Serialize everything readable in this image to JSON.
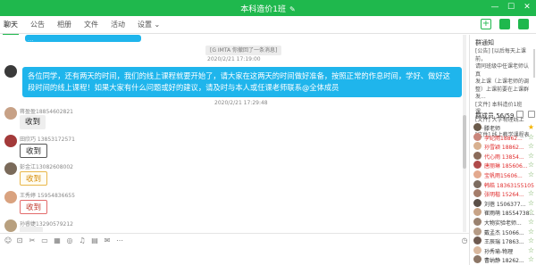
{
  "window": {
    "title": "本科造价1班",
    "edit_glyph": "✎",
    "controls": [
      "—",
      "☐",
      "✕"
    ]
  },
  "tabs": [
    {
      "label": "聊天",
      "active": true
    },
    {
      "label": "公告"
    },
    {
      "label": "相册"
    },
    {
      "label": "文件"
    },
    {
      "label": "活动"
    },
    {
      "label": "设置 ⌄"
    }
  ],
  "chat": {
    "top_bubble_text": "...",
    "system_notice": "[G IMTA 你撤回了一条消息]",
    "stamp1": "2020/2/21 17:19:00",
    "main_message": "各位同学，还有两天的时间，我们的线上课程就要开始了，请大家在这两天的时间做好准备，按照正常的作息时间，学好、做好这段时间的线上课程！如果大家有什么问题或好的建议，请及时与本人或任课老师联系@全体成员",
    "stamp2": "2020/2/21 17:29:48",
    "replies": [
      {
        "sender": "蒋盈盈18854602821",
        "text": "收到",
        "style": "grey"
      },
      {
        "sender": "田欣巧 13853172571",
        "text": "收到",
        "style": "outline-dark"
      },
      {
        "sender": "彭金江13082608002",
        "text": "收到",
        "style": "outline-yellow"
      },
      {
        "sender": "王秀婷 15954836655",
        "text": "收到",
        "style": "outline-red"
      },
      {
        "sender": "孙睿婕13290579212",
        "text": "",
        "style": "grey"
      }
    ]
  },
  "input_toolbar": {
    "icons": [
      "☺",
      "⊡",
      "✂",
      "▭",
      "▦",
      "◎",
      "♫",
      "▤",
      "✉",
      "⋯"
    ],
    "history_icon": "◷"
  },
  "right_panel": {
    "notice_title": "群通知",
    "notice_lines": [
      "[公告] [以后每天上课前，",
      "请同班级中任课老师认真",
      "发上课（上课老师的调",
      "整）上课前要在上课群发...",
      "[文件] 本科造价1班课...",
      "[文件] 大学物理线上课...",
      "[文件] 线上教学课程表"
    ],
    "members_title": "群成员 56/59",
    "members": [
      {
        "name": "滕老师",
        "color": "#333",
        "role": "★",
        "role_color": "#f4b400"
      },
      {
        "name": "李纪雨18862...",
        "color": "#e02b2b",
        "role": "☆",
        "role_color": "#6aa84f"
      },
      {
        "name": "孙雪颖 18862...",
        "color": "#e02b2b",
        "role": "☆",
        "role_color": "#6aa84f"
      },
      {
        "name": "代心雨 13854...",
        "color": "#e02b2b",
        "role": "☆",
        "role_color": "#6aa84f"
      },
      {
        "name": "唐丽琳 185606...",
        "color": "#e02b2b",
        "role": "☆",
        "role_color": "#6aa84f"
      },
      {
        "name": "宝帆雨15606...",
        "color": "#e02b2b",
        "role": "☆",
        "role_color": "#6aa84f"
      },
      {
        "name": "韩皓 18363155105",
        "color": "#e02b2b",
        "role": "",
        "role_color": "#999"
      },
      {
        "name": "张明楷 15264...",
        "color": "#e02b2b",
        "role": "☆",
        "role_color": "#6aa84f"
      },
      {
        "name": "刘蓓 1506377...",
        "color": "#333",
        "role": "☆",
        "role_color": "#6aa84f"
      },
      {
        "name": "崔雨萌 18554738...",
        "color": "#333",
        "role": "☆",
        "role_color": "#6aa84f"
      },
      {
        "name": "大物实验老师...",
        "color": "#333",
        "role": "☆",
        "role_color": "#6aa84f"
      },
      {
        "name": "戴孟杰 15066...",
        "color": "#333",
        "role": "☆",
        "role_color": "#6aa84f"
      },
      {
        "name": "王辰瑞 17863...",
        "color": "#333",
        "role": "☆",
        "role_color": "#6aa84f"
      },
      {
        "name": "孙秀瑜-物理",
        "color": "#333",
        "role": "☆",
        "role_color": "#6aa84f"
      },
      {
        "name": "曹纳静 18262...",
        "color": "#333",
        "role": "☆",
        "role_color": "#6aa84f"
      }
    ]
  },
  "colors": {
    "brand": "#1fb84d",
    "bubble": "#1fb5ec"
  }
}
